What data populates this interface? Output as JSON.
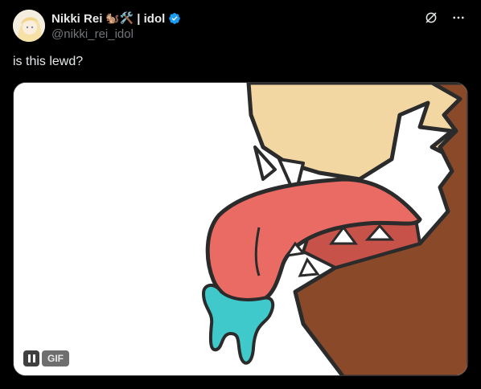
{
  "author": {
    "display_name": "Nikki Rei",
    "name_suffix": "| idol",
    "name_emojis": "🐿️🛠️",
    "handle": "@nikki_rei_idol",
    "verified": true,
    "verified_color": "#1d9bf0"
  },
  "tweet": {
    "text": "is this lewd?"
  },
  "media": {
    "type": "GIF",
    "gif_label": "GIF",
    "pause_icon": "pause-icon"
  },
  "header_icons": [
    "grok-icon",
    "more-icon"
  ],
  "colors": {
    "background": "#000000",
    "text": "#e7e9ea",
    "secondary_text": "#71767b",
    "tongue": "#e96b63",
    "drool": "#3fc9cb",
    "fur": "#f2d9a4",
    "body": "#8a4b2a"
  }
}
